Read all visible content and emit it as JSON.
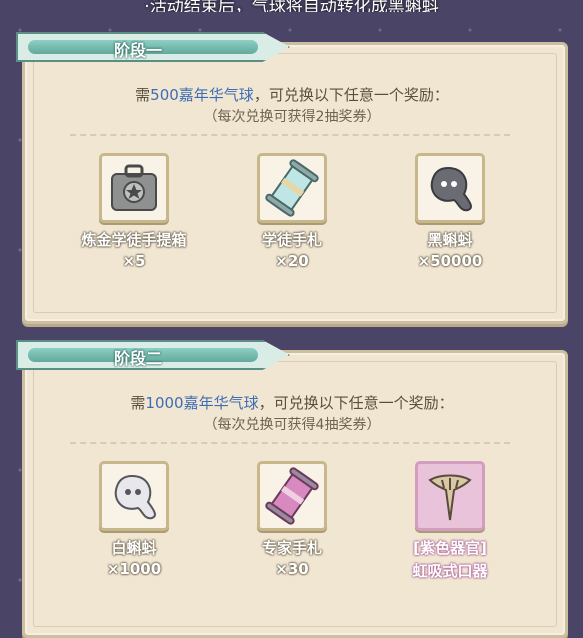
{
  "banner": "·活动结束后，气球将自动转化成黑蝌蚪",
  "stages": [
    {
      "title": "阶段一",
      "req_prefix": "需",
      "req_amount": "500嘉年华气球",
      "req_suffix": "，可兑换以下任意一个奖励：",
      "note": "（每次兑换可获得2抽奖券）",
      "rewards": [
        {
          "name": "炼金学徒手提箱",
          "qty": "×5",
          "icon": "suitcase-icon"
        },
        {
          "name": "学徒手札",
          "qty": "×20",
          "icon": "scroll-icon"
        },
        {
          "name": "黑蝌蚪",
          "qty": "×50000",
          "icon": "black-tadpole-icon"
        }
      ]
    },
    {
      "title": "阶段二",
      "req_prefix": "需",
      "req_amount": "1000嘉年华气球",
      "req_suffix": "，可兑换以下任意一个奖励：",
      "note": "（每次兑换可获得4抽奖券）",
      "rewards": [
        {
          "name": "白蝌蚪",
          "qty": "×1000",
          "icon": "white-tadpole-icon"
        },
        {
          "name": "专家手札",
          "qty": "×30",
          "icon": "expert-scroll-icon"
        },
        {
          "name": "[紫色器官]",
          "qty": "虹吸式口器",
          "icon": "siphon-mouthpart-icon"
        }
      ]
    }
  ],
  "colors": {
    "accent": "#3d6db5",
    "tab": "#62a99c",
    "purple": "#e8c3da",
    "panel": "#f0e6d2"
  }
}
